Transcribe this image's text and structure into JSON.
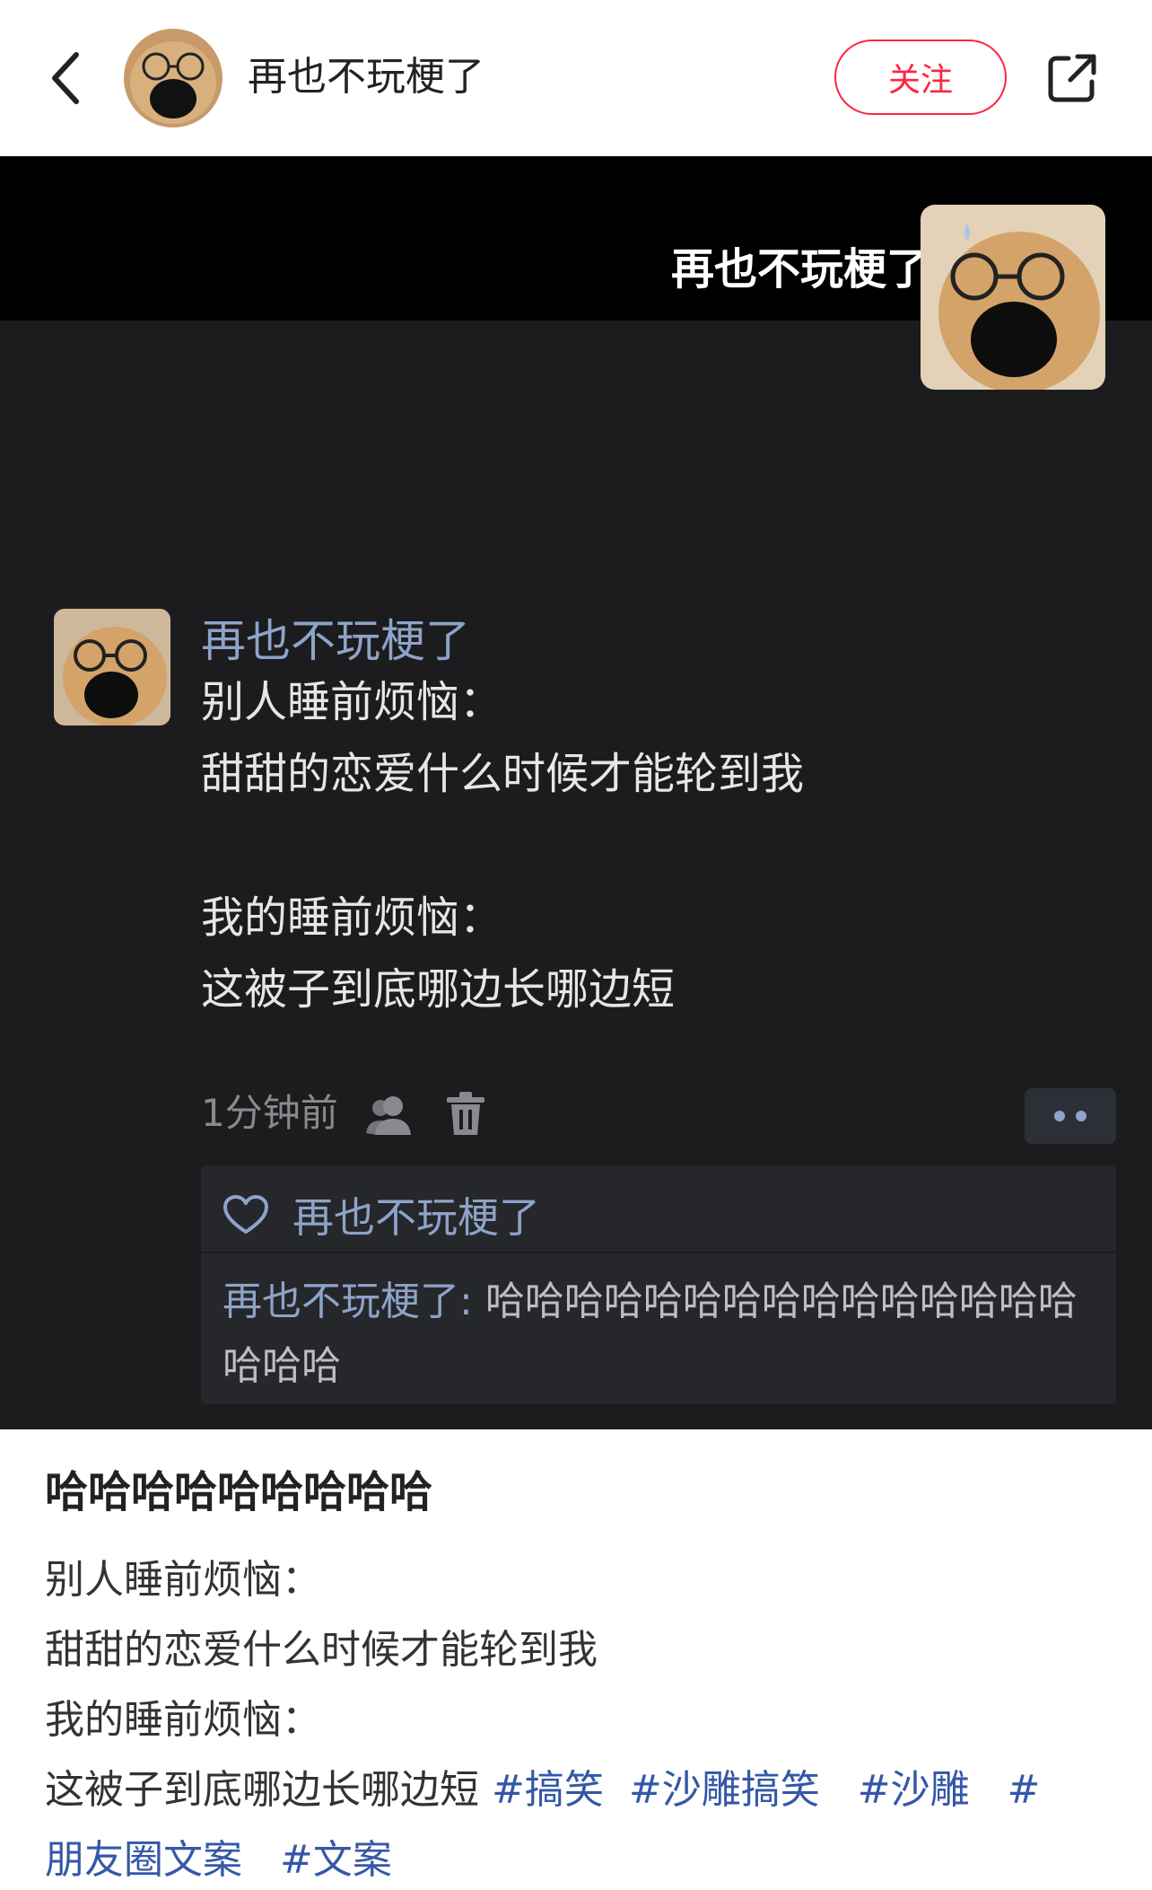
{
  "header": {
    "username": "再也不玩梗了",
    "follow_label": "关注"
  },
  "image": {
    "header_name": "再也不玩梗了",
    "message": {
      "sender": "再也不玩梗了",
      "lines": [
        "别人睡前烦恼：",
        "甜甜的恋爱什么时候才能轮到我",
        "",
        "我的睡前烦恼：",
        "这被子到底哪边长哪边短"
      ],
      "time": "1分钟前"
    },
    "comments": {
      "liker": "再也不玩梗了",
      "author": "再也不玩梗了",
      "separator": ": ",
      "text": "哈哈哈哈哈哈哈哈哈哈哈哈哈哈哈哈哈哈"
    }
  },
  "note": {
    "title": "哈哈哈哈哈哈哈哈哈",
    "lines": [
      "别人睡前烦恼：",
      "甜甜的恋爱什么时候才能轮到我",
      "我的睡前烦恼："
    ],
    "last_line": "这被子到底哪边长哪边短",
    "tags": [
      "#搞笑",
      "#沙雕搞笑",
      "#沙雕",
      "#",
      "朋友圈文案",
      "#文案"
    ]
  },
  "colors": {
    "accent": "#ff2442",
    "link": "#3457a8",
    "dark_bg": "#1c1c1e",
    "name_blue": "#8ea3c8"
  },
  "icons": [
    "back-arrow-icon",
    "share-icon",
    "friends-icon",
    "trash-icon",
    "heart-icon",
    "more-icon"
  ]
}
